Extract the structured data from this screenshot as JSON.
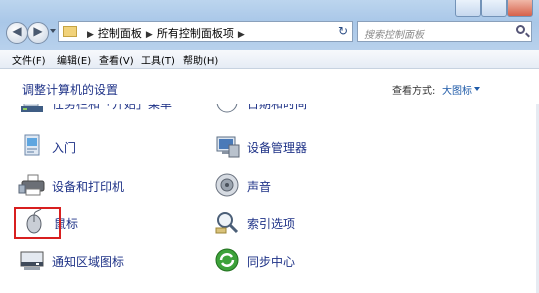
{
  "nav": {
    "back_glyph": "◀",
    "forward_glyph": "▶",
    "breadcrumbs": [
      "控制面板",
      "所有控制面板项"
    ],
    "refresh_glyph": "↻",
    "search_placeholder": "搜索控制面板"
  },
  "menu": [
    "文件(F)",
    "编辑(E)",
    "查看(V)",
    "工具(T)",
    "帮助(H)"
  ],
  "header": {
    "title": "调整计算机的设置",
    "view_label": "查看方式:",
    "view_value": "大图标"
  },
  "left_items": [
    {
      "label": "任务栏和「开始」菜单",
      "icon": "taskbar-icon"
    },
    {
      "label": "入门",
      "icon": "getting-started-icon"
    },
    {
      "label": "设备和打印机",
      "icon": "printer-icon"
    },
    {
      "label": "鼠标",
      "icon": "mouse-icon"
    },
    {
      "label": "通知区域图标",
      "icon": "notification-icon"
    }
  ],
  "right_items": [
    {
      "label": "日期和时间",
      "icon": "clock-icon"
    },
    {
      "label": "设备管理器",
      "icon": "device-manager-icon"
    },
    {
      "label": "声音",
      "icon": "speaker-icon"
    },
    {
      "label": "索引选项",
      "icon": "indexing-icon"
    },
    {
      "label": "同步中心",
      "icon": "sync-icon"
    }
  ],
  "colors": {
    "link": "#1e3287",
    "highlight_border": "#d81f1f",
    "title_bar": "#a9c7e8"
  }
}
